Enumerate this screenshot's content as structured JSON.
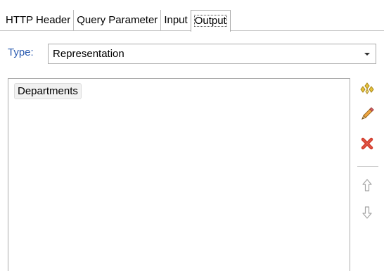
{
  "tabs": [
    {
      "label": "HTTP Header",
      "active": false
    },
    {
      "label": "Query Parameter",
      "active": false
    },
    {
      "label": "Input",
      "active": false
    },
    {
      "label": "Output",
      "active": true
    }
  ],
  "type": {
    "label": "Type:",
    "value": "Representation"
  },
  "list": {
    "items": [
      "Departments"
    ]
  },
  "side_buttons": {
    "add": "add-icon",
    "edit": "pencil-icon",
    "delete": "delete-icon",
    "up": "arrow-up-icon",
    "down": "arrow-down-icon"
  },
  "colors": {
    "type_label": "#2b5bb0",
    "delete_red": "#d23b2b",
    "add_gold": "#d7b22a"
  }
}
